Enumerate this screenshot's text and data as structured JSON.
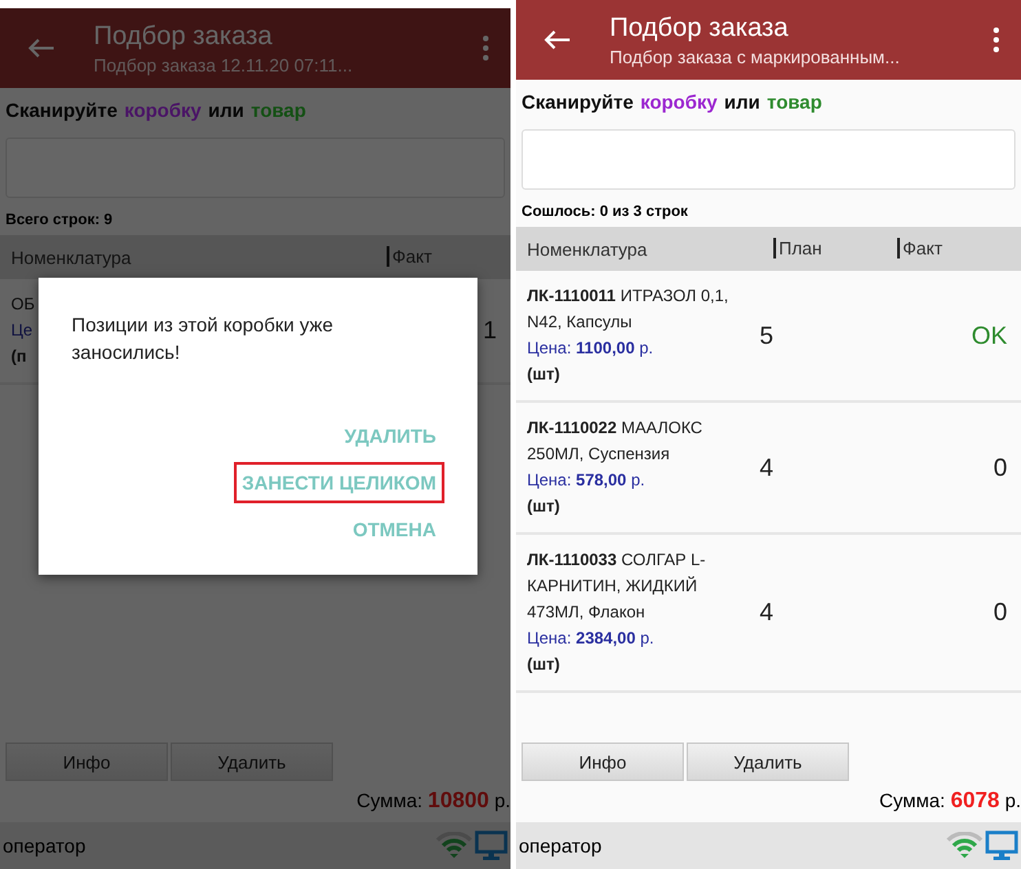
{
  "phones": [
    {
      "title": "Подбор заказа",
      "subtitle": "Подбор заказа 12.11.20 07:11...",
      "prompt": [
        {
          "text": "Сканируйте",
          "color": "#070707"
        },
        {
          "text": "коробку",
          "color": "#4a1466"
        },
        {
          "text": "или",
          "color": "#070707"
        },
        {
          "text": "товар",
          "color": "#145014"
        }
      ],
      "count": "Всего строк: 9",
      "columns": [
        "Номенклатура",
        "Факт"
      ],
      "rows": [
        {
          "name": "ОБ",
          "price": "Це",
          "unit": "(п",
          "fact": "1",
          "done": false
        }
      ],
      "buttons": [
        "Инфо",
        "Удалить"
      ],
      "sum": {
        "label": "Сумма:",
        "value": "10800",
        "unit": "р."
      },
      "status": "оператор",
      "dialog": {
        "message": "Позиции из этой коробки уже заносились!",
        "actions": [
          {
            "label": "УДАЛИТЬ",
            "highlighted": false
          },
          {
            "label": "ЗАНЕСТИ ЦЕЛИКОМ",
            "highlighted": true
          },
          {
            "label": "ОТМЕНА",
            "highlighted": false
          }
        ]
      }
    },
    {
      "title": "Подбор заказа",
      "subtitle": "Подбор заказа с маркированным...",
      "prompt": [
        {
          "text": "Сканируйте",
          "color": "#111111"
        },
        {
          "text": "коробку",
          "color": "#9c27d0"
        },
        {
          "text": "или",
          "color": "#111111"
        },
        {
          "text": "товар",
          "color": "#2e8b2e"
        }
      ],
      "count": "Сошлось: 0 из 3 строк",
      "columns": [
        "Номенклатура",
        "План",
        "Факт"
      ],
      "rows": [
        {
          "name": "**ЛК-1110011** ИТРАЗОЛ 0,1, N42, Капсулы",
          "price": "Цена: **1100,00** р.",
          "unit": "(шт)",
          "plan": "5",
          "fact": "OK",
          "done": true
        },
        {
          "name": "**ЛК-1110022** МААЛОКС 250МЛ, Суспензия",
          "price": "Цена: **578,00** р.",
          "unit": "(шт)",
          "plan": "4",
          "fact": "0",
          "done": false
        },
        {
          "name": "**ЛК-1110033** СОЛГАР L-КАРНИТИН, ЖИДКИЙ 473МЛ, Флакон",
          "price": "Цена: **2384,00** р.",
          "unit": "(шт)",
          "plan": "4",
          "fact": "0",
          "done": false
        }
      ],
      "buttons": [
        "Инфо",
        "Удалить"
      ],
      "sum": {
        "label": "Сумма:",
        "value": "6078",
        "unit": "р."
      },
      "status": "оператор"
    }
  ]
}
